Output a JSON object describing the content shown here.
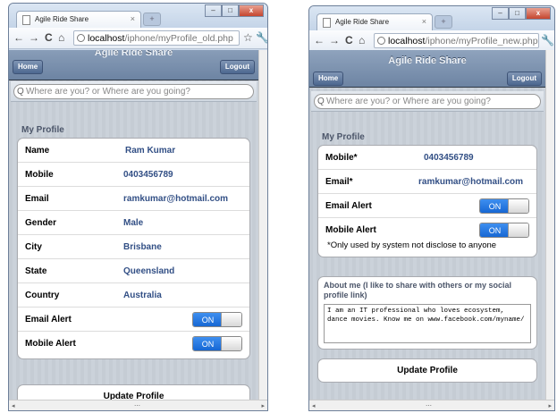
{
  "left": {
    "tab_title": "Agile Ride Share",
    "url_host": "localhost",
    "url_path": "/iphone/myProfile_old.php",
    "app_title": "Agile Ride Share",
    "home_label": "Home",
    "logout_label": "Logout",
    "search_placeholder": "Where are you? or Where are you going?",
    "section_title": "My Profile",
    "rows": [
      {
        "label": "Name",
        "value": "Ram Kumar"
      },
      {
        "label": "Mobile",
        "value": "0403456789"
      },
      {
        "label": "Email",
        "value": "ramkumar@hotmail.com"
      },
      {
        "label": "Gender",
        "value": "Male"
      },
      {
        "label": "City",
        "value": "Brisbane"
      },
      {
        "label": "State",
        "value": "Queensland"
      },
      {
        "label": "Country",
        "value": "Australia"
      }
    ],
    "toggles": [
      {
        "label": "Email Alert",
        "state": "ON"
      },
      {
        "label": "Mobile Alert",
        "state": "ON"
      }
    ],
    "update_button": "Update Profile"
  },
  "right": {
    "tab_title": "Agile Ride Share",
    "url_host": "localhost",
    "url_path": "/iphone/myProfile_new.php",
    "app_title": "Agile Ride Share",
    "home_label": "Home",
    "logout_label": "Logout",
    "search_placeholder": "Where are you? or Where are you going?",
    "section_title": "My Profile",
    "rows": [
      {
        "label": "Mobile*",
        "value": "0403456789"
      },
      {
        "label": "Email*",
        "value": "ramkumar@hotmail.com"
      }
    ],
    "toggles": [
      {
        "label": "Email Alert",
        "state": "ON"
      },
      {
        "label": "Mobile Alert",
        "state": "ON"
      }
    ],
    "note": "*Only used by system not disclose to anyone",
    "about_label": "About me (I like to share with others or my social profile link)",
    "about_text": "I am an IT professional who loves ecosystem, dance movies. Know me on www.facebook.com/myname/",
    "update_button": "Update Profile"
  },
  "colors": {
    "accent": "#1667d3",
    "value_text": "#324f85",
    "header": "#6d84a3"
  }
}
